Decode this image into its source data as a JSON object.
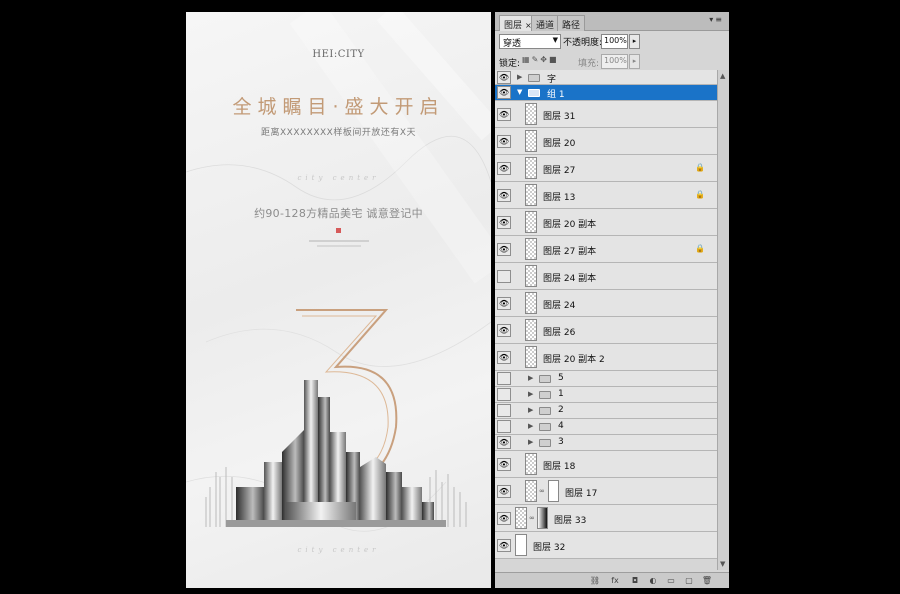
{
  "poster": {
    "logo": "HEI:CITY",
    "headline": "全城瞩目·盛大开启",
    "subline": "距离XXXXXXXX样板间开放还有X天",
    "script_top": "city center",
    "feature": "约90-128方精品美宅  诚意登记中",
    "big_number": "3",
    "script_bottom": "city center"
  },
  "panel": {
    "tabs": [
      {
        "label": "图层",
        "active": true,
        "close": "×"
      },
      {
        "label": "通道",
        "active": false
      },
      {
        "label": "路径",
        "active": false
      }
    ],
    "menu_icon": "panel-menu-icon",
    "blend_mode": "穿透",
    "opacity_label": "不透明度:",
    "opacity_value": "100%",
    "lock_label": "锁定:",
    "fill_label": "填充:",
    "fill_value": "100%",
    "layers": [
      {
        "name": "字",
        "kind": "group",
        "visible": true,
        "expanded": false,
        "indent": 0,
        "selected": false
      },
      {
        "name": "组 1",
        "kind": "group",
        "visible": true,
        "expanded": true,
        "indent": 0,
        "selected": true
      },
      {
        "name": "图层 31",
        "kind": "layer",
        "visible": true,
        "locked": false,
        "selected": false
      },
      {
        "name": "图层 20",
        "kind": "layer",
        "visible": true,
        "locked": false,
        "selected": false
      },
      {
        "name": "图层 27",
        "kind": "layer",
        "visible": true,
        "locked": true,
        "selected": false
      },
      {
        "name": "图层 13",
        "kind": "layer",
        "visible": true,
        "locked": true,
        "selected": false
      },
      {
        "name": "图层 20 副本",
        "kind": "layer",
        "visible": true,
        "locked": false,
        "selected": false
      },
      {
        "name": "图层 27 副本",
        "kind": "layer",
        "visible": true,
        "locked": true,
        "selected": false
      },
      {
        "name": "图层 24 副本",
        "kind": "layer",
        "visible": false,
        "locked": false,
        "selected": false
      },
      {
        "name": "图层 24",
        "kind": "layer",
        "visible": true,
        "locked": false,
        "selected": false
      },
      {
        "name": "图层 26",
        "kind": "layer",
        "visible": true,
        "locked": false,
        "selected": false
      },
      {
        "name": "图层 20 副本 2",
        "kind": "layer",
        "visible": true,
        "locked": false,
        "selected": false
      },
      {
        "name": "5",
        "kind": "subgroup",
        "visible": false,
        "selected": false
      },
      {
        "name": "1",
        "kind": "subgroup",
        "visible": false,
        "selected": false
      },
      {
        "name": "2",
        "kind": "subgroup",
        "visible": false,
        "selected": false
      },
      {
        "name": "4",
        "kind": "subgroup",
        "visible": false,
        "selected": false
      },
      {
        "name": "3",
        "kind": "subgroup",
        "visible": true,
        "selected": false
      },
      {
        "name": "图层 18",
        "kind": "layer",
        "visible": true,
        "locked": false,
        "selected": false
      },
      {
        "name": "图层 17",
        "kind": "masked",
        "visible": true,
        "selected": false
      },
      {
        "name": "图层 33",
        "kind": "masked-top",
        "visible": true,
        "selected": false
      },
      {
        "name": "图层 32",
        "kind": "top-plain",
        "visible": true,
        "selected": false
      }
    ],
    "footer_icons": [
      "link-layers-icon",
      "fx-icon",
      "add-mask-icon",
      "adjustment-layer-icon",
      "new-group-icon",
      "new-layer-icon",
      "delete-layer-icon"
    ],
    "footer_glyphs": [
      "⛓",
      "fx",
      "◘",
      "◐",
      "▭",
      "▢",
      "🗑"
    ]
  },
  "colors": {
    "accent_gold": "#c29a76",
    "selection_blue": "#1a73c8"
  }
}
